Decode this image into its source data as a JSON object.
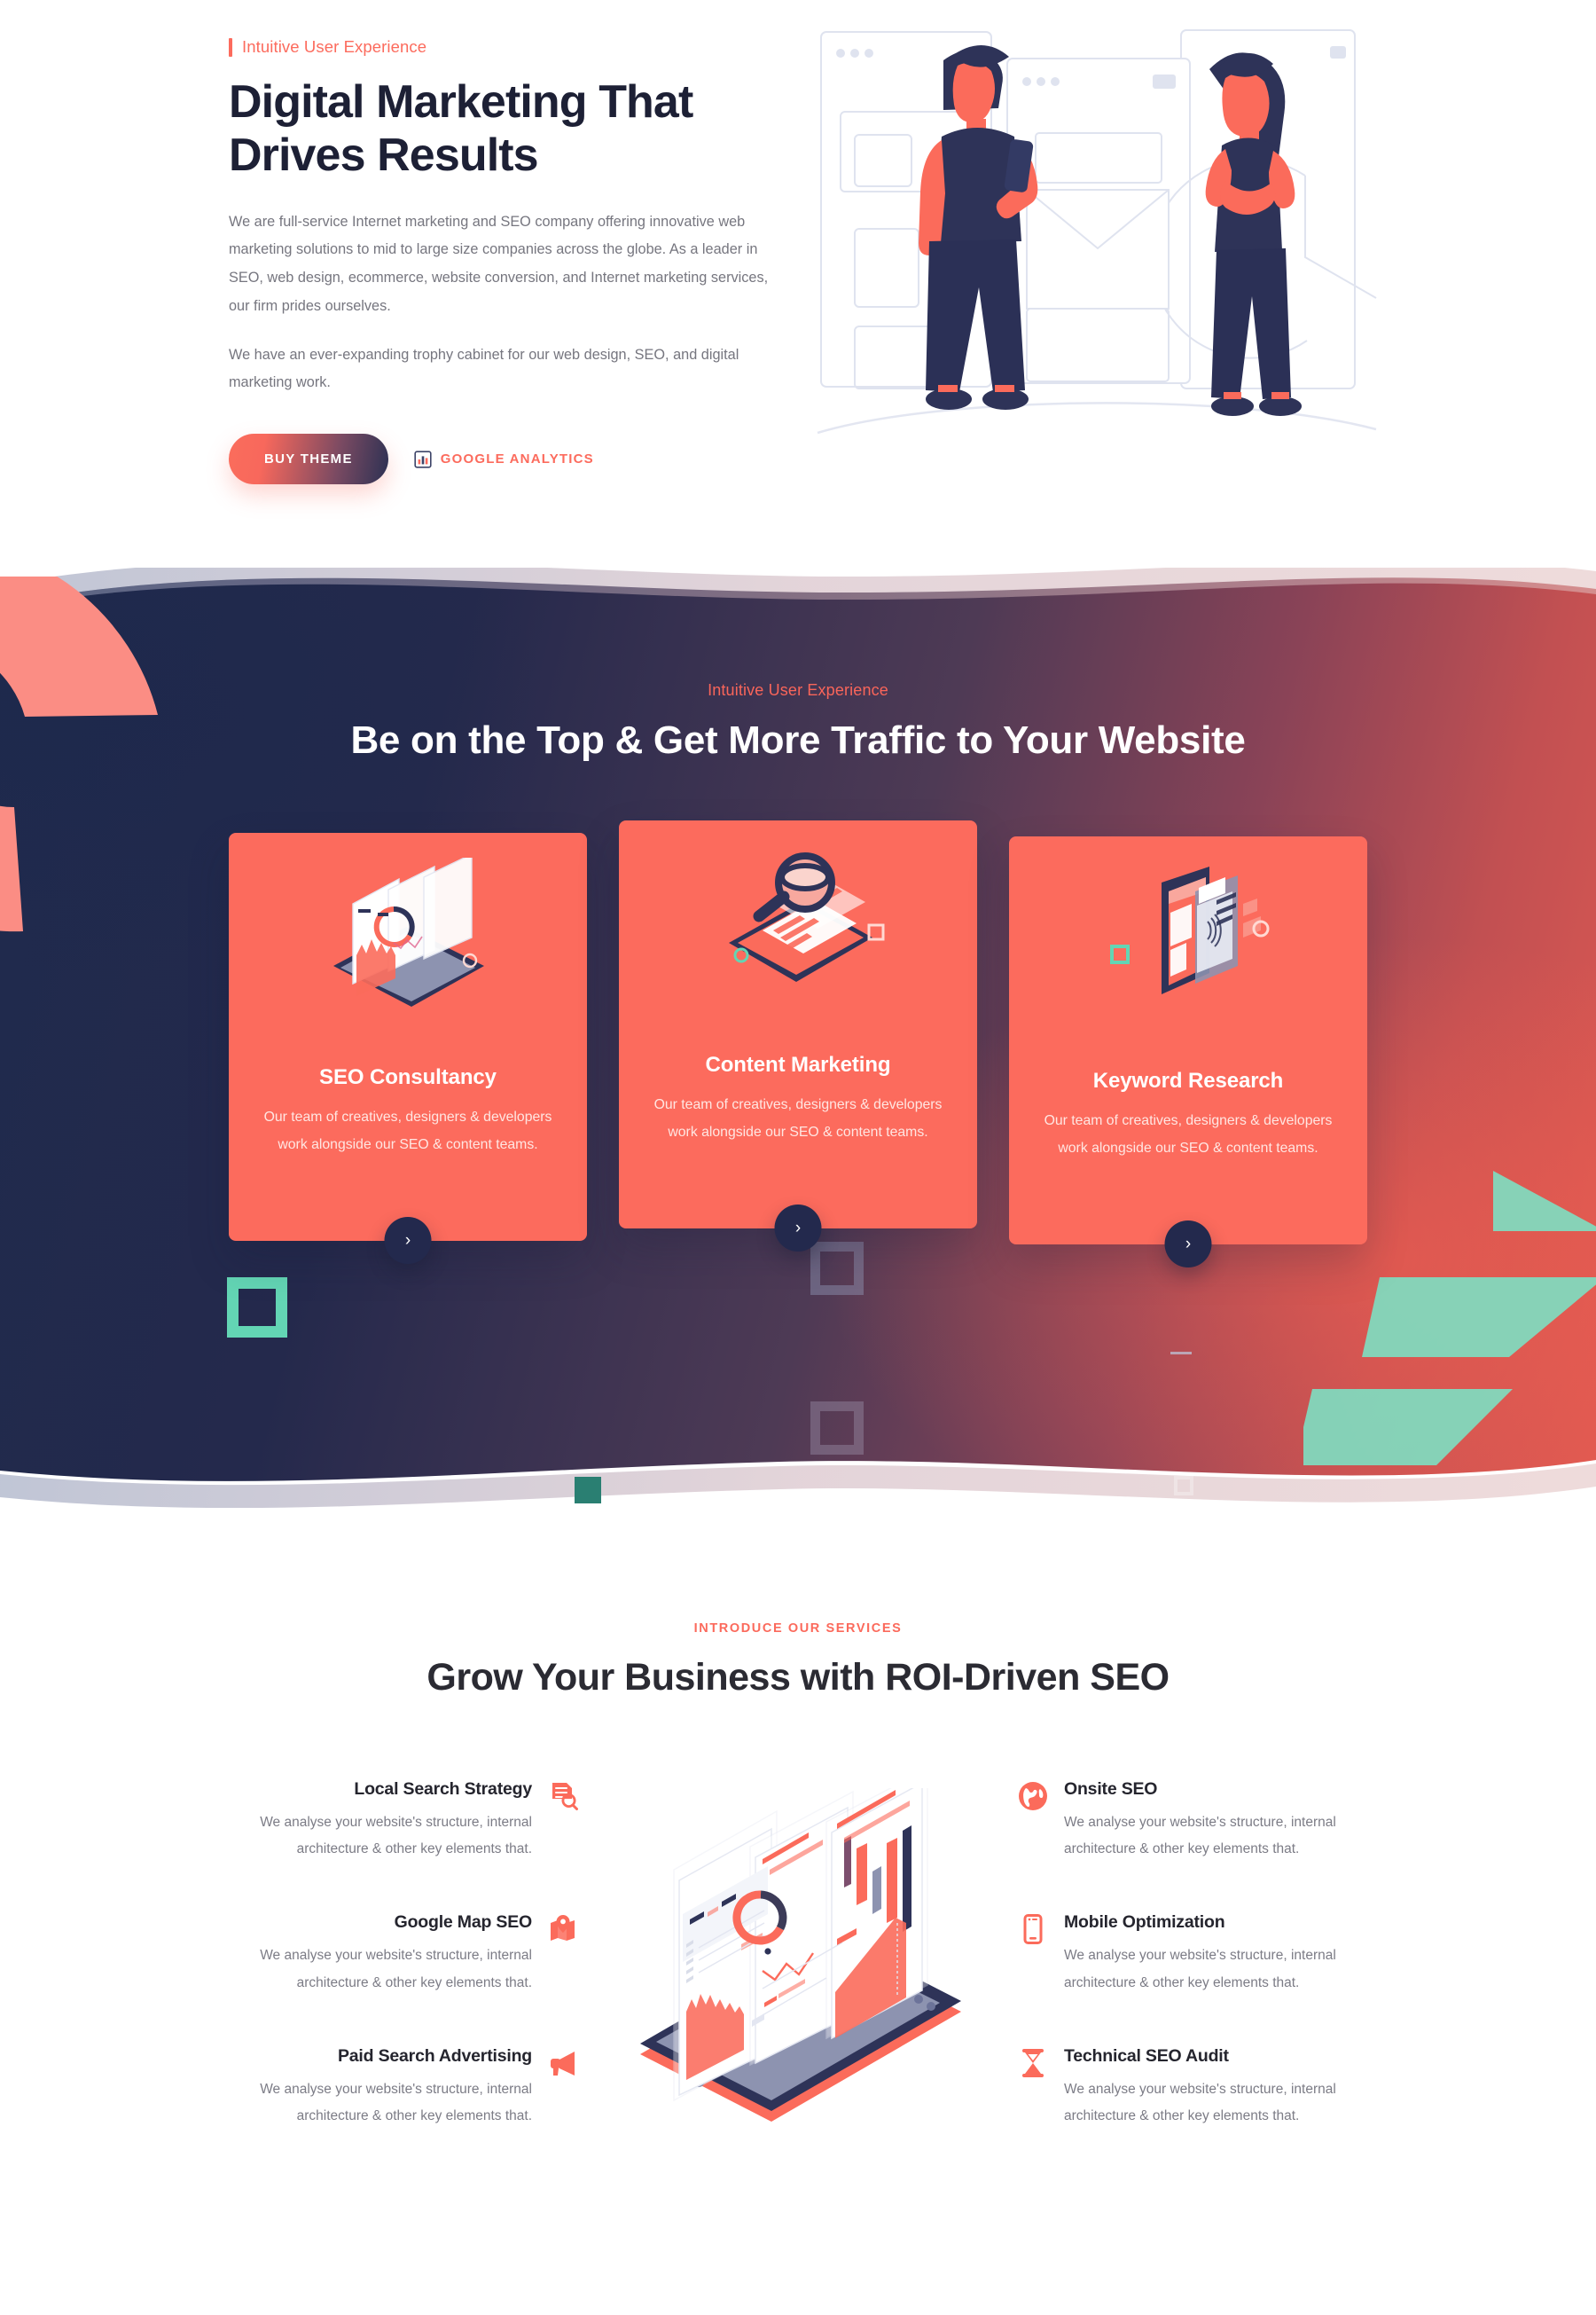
{
  "hero": {
    "eyebrow": "Intuitive User Experience",
    "title": "Digital Marketing That Drives Results",
    "paragraph1": "We are full-service Internet marketing and SEO company offering innovative web marketing solutions to mid to large size companies across the globe. As a leader in SEO, web design, ecommerce, website conversion, and Internet marketing services, our firm prides ourselves.",
    "paragraph2": "We have an ever-expanding trophy cabinet for our web design, SEO, and digital marketing work.",
    "primary_button": "BUY THEME",
    "secondary_link": "GOOGLE ANALYTICS",
    "secondary_icon": "bar-chart-icon",
    "illustration": "two-people-with-browser-windows-and-envelope"
  },
  "band": {
    "eyebrow": "Intuitive User Experience",
    "title": "Be on the Top & Get More Traffic to Your Website",
    "arrow_glyph": "›",
    "cards": [
      {
        "title": "SEO Consultancy",
        "desc": "Our team of creatives, designers & developers work alongside our SEO & content teams.",
        "icon": "isometric-laptop-analytics-icon"
      },
      {
        "title": "Content Marketing",
        "desc": "Our team of creatives, designers & developers work alongside our SEO & content teams.",
        "icon": "isometric-magnifier-document-icon"
      },
      {
        "title": "Keyword Research",
        "desc": "Our team of creatives, designers & developers work alongside our SEO & content teams.",
        "icon": "isometric-tablet-fingerprint-icon"
      }
    ]
  },
  "services": {
    "eyebrow": "INTRODUCE OUR SERVICES",
    "title": "Grow Your Business with ROI-Driven SEO",
    "illustration": "isometric-tablet-with-charts",
    "left_items": [
      {
        "title": "Local Search Strategy",
        "desc": "We analyse your website's structure, internal architecture & other key elements that.",
        "icon": "document-search-icon"
      },
      {
        "title": "Google Map SEO",
        "desc": "We analyse your website's structure, internal architecture & other key elements that.",
        "icon": "map-pin-icon"
      },
      {
        "title": "Paid Search Advertising",
        "desc": "We analyse your website's structure, internal architecture & other key elements that.",
        "icon": "megaphone-icon"
      }
    ],
    "right_items": [
      {
        "title": "Onsite SEO",
        "desc": "We analyse your website's structure, internal architecture & other key elements that.",
        "icon": "globe-icon"
      },
      {
        "title": "Mobile Optimization",
        "desc": "We analyse your website's structure, internal architecture & other key elements that.",
        "icon": "mobile-phone-icon"
      },
      {
        "title": "Technical SEO Audit",
        "desc": "We analyse your website's structure, internal architecture & other key elements that.",
        "icon": "hourglass-icon"
      }
    ]
  },
  "colors": {
    "accent": "#fc6b5d",
    "dark": "#1d2035",
    "teal": "#63d5b4",
    "navy_card_button": "#23294d",
    "body_text": "#76767f"
  }
}
